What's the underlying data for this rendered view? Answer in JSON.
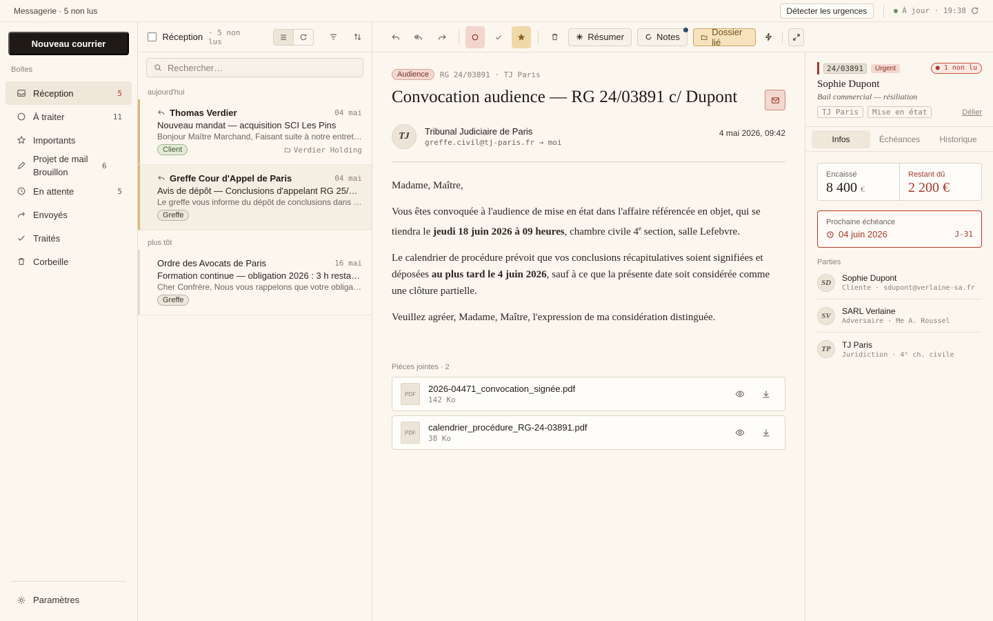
{
  "topbar": {
    "title": "Messagerie · 5 non lus",
    "detect_button": "Détecter les urgences",
    "sync_status": "À jour · 19:38"
  },
  "sidebar": {
    "compose_label": "Nouveau courrier",
    "section_label": "Boîtes",
    "items": [
      {
        "label": "Réception",
        "count": "5",
        "icon": "inbox-icon"
      },
      {
        "label": "À traiter",
        "count": "11",
        "icon": "circle-icon"
      },
      {
        "label": "Importants",
        "count": "",
        "icon": "star-icon"
      },
      {
        "label": "Projet de mail Brouillon",
        "count": "6",
        "icon": "pencil-icon"
      },
      {
        "label": "En attente",
        "count": "5",
        "icon": "clock-icon"
      },
      {
        "label": "Envoyés",
        "count": "",
        "icon": "forward-arrow-icon"
      },
      {
        "label": "Traités",
        "count": "",
        "icon": "check-icon"
      },
      {
        "label": "Corbeille",
        "count": "",
        "icon": "trash-icon"
      }
    ],
    "settings_label": "Paramètres"
  },
  "list": {
    "title": "Réception",
    "unread": "· 5 non lus",
    "search_placeholder": "Rechercher…",
    "group_today": "aujourd'hui",
    "group_earlier": "plus tôt",
    "messages": [
      {
        "from": "Thomas Verdier",
        "date": "04 mai",
        "subject": "Nouveau mandat — acquisition SCI Les Pins",
        "preview": "Bonjour Maître Marchand, Faisant suite à notre entretien…",
        "tag": "Client",
        "folder": "Verdier Holding"
      },
      {
        "from": "Greffe Cour d'Appel de Paris",
        "date": "04 mai",
        "subject": "Avis de dépôt — Conclusions d'appelant RG 25/0…",
        "preview": "Le greffe vous informe du dépôt de conclusions dans l…",
        "tag": "Greffe"
      },
      {
        "from": "Ordre des Avocats de Paris",
        "date": "16 mai",
        "subject": "Formation continue — obligation 2026 : 3 h restant…",
        "preview": "Cher Confrère, Nous vous rappelons que votre obligati…",
        "tag": "Greffe"
      }
    ]
  },
  "toolbar": {
    "summarize": "Résumer",
    "notes": "Notes",
    "linked_folder": "Dossier lié"
  },
  "reader": {
    "tag": "Audience",
    "case_ref": "RG 24/03891 · TJ Paris",
    "title": "Convocation audience — RG 24/03891 c/ Dupont",
    "sender_initials": "TJ",
    "sender_name": "Tribunal Judiciaire de Paris",
    "sender_address": "greffe.civil@tj-paris.fr → moi",
    "date": "4 mai 2026, 09:42",
    "greeting": "Madame, Maître,",
    "p1_a": "Vous êtes convoquée à l'audience de mise en état dans l'affaire référencée en objet, qui se tiendra le ",
    "p1_bold": "jeudi 18 juin 2026 à 09 heures",
    "p1_b": ", chambre civile 4",
    "p1_sup": "e",
    "p1_c": " section, salle Lefebvre.",
    "p2_a": "Le calendrier de procédure prévoit que vos conclusions récapitulatives soient signifiées et déposées ",
    "p2_bold": "au plus tard le 4 juin 2026",
    "p2_b": ", sauf à ce que la présente date soit considérée comme une clôture partielle.",
    "p3": "Veuillez agréer, Madame, Maître, l'expression de ma considération distinguée.",
    "attachments_label": "Pièces jointes · 2",
    "attachments": [
      {
        "type": "PDF",
        "name": "2026-04471_convocation_signée.pdf",
        "size": "142 Ko"
      },
      {
        "type": "PDF",
        "name": "calendrier_procédure_RG-24-03891.pdf",
        "size": "38 Ko"
      }
    ]
  },
  "panel": {
    "code": "24/03891",
    "urgent": "Urgent",
    "unread": "1 non lu",
    "client_name": "Sophie Dupont",
    "matter": "Bail commercial — résiliation",
    "chip1": "TJ Paris",
    "chip2": "Mise en état",
    "unlink": "Délier",
    "tabs": [
      "Infos",
      "Échéances",
      "Historique"
    ],
    "cashed_label": "Encaissé",
    "cashed_value": "8 400",
    "cashed_unit": "€",
    "due_label": "Restant dû",
    "due_value": "2 200 €",
    "deadline_label": "Prochaine échéance",
    "deadline_date": "04 juin 2026",
    "deadline_countdown": "J-31",
    "parties_label": "Parties",
    "parties": [
      {
        "initials": "SD",
        "name": "Sophie Dupont",
        "detail": "Cliente · sdupont@verlaine-sa.fr"
      },
      {
        "initials": "SV",
        "name": "SARL Verlaine",
        "detail": "Adversaire · Me A. Roussel"
      },
      {
        "initials": "TP",
        "name": "TJ Paris",
        "detail": "Juridiction · 4ᵉ ch. civile"
      }
    ]
  }
}
